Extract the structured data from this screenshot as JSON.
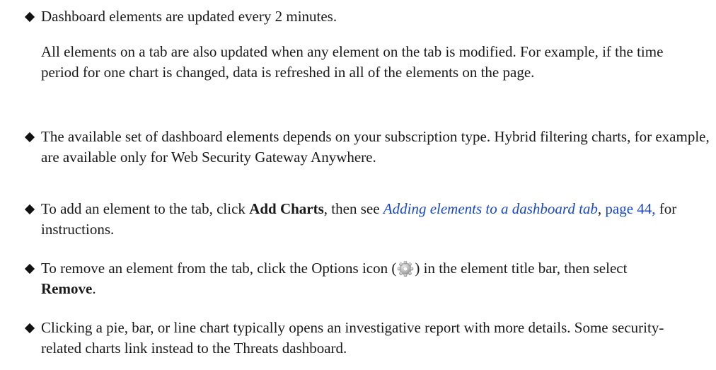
{
  "b1": {
    "text": "Dashboard elements are updated every 2 minutes."
  },
  "b1_sub": {
    "text": "All elements on a tab are also updated when any element on the tab is modified. For example, if the time period for one chart is changed, data is refreshed in all of the elements on the page."
  },
  "b2": {
    "text": "The available set of dashboard elements depends on your subscription type. Hybrid filtering charts, for example, are available only for Web Security Gateway Anywhere."
  },
  "b3": {
    "pre": "To add an element to the tab, click ",
    "bold": "Add Charts",
    "mid": ", then see ",
    "link": "Adding elements to a dashboard tab",
    "comma": ", ",
    "page_link": "page 44,",
    "post": " for instructions."
  },
  "b4": {
    "pre": "To remove an element from the tab, click the Options icon (",
    "icon": "gear-icon",
    "mid": ") in the element title bar, then select ",
    "bold": "Remove",
    "post": "."
  },
  "b5": {
    "text": "Clicking a pie, bar, or line chart typically opens an investigative report with more details. Some security-related charts link instead to the Threats dashboard."
  },
  "colors": {
    "link": "#1a47c9",
    "text": "#1a1a1a"
  }
}
